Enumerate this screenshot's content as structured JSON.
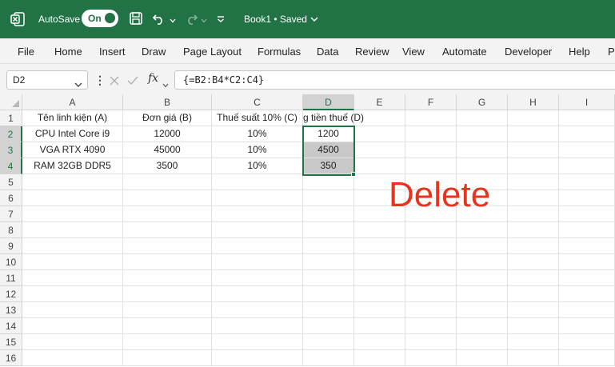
{
  "titlebar": {
    "autosave_label": "AutoSave",
    "autosave_state": "On",
    "document_title": "Book1 • Saved"
  },
  "ribbon": {
    "tabs": [
      "File",
      "Home",
      "Insert",
      "Draw",
      "Page Layout",
      "Formulas",
      "Data",
      "Review",
      "View",
      "Automate",
      "Developer",
      "Help",
      "Po"
    ]
  },
  "formula_bar": {
    "name_box": "D2",
    "fx_label": "fx",
    "formula": "{=B2:B4*C2:C4}"
  },
  "sheet": {
    "columns": [
      "A",
      "B",
      "C",
      "D",
      "E",
      "F",
      "G",
      "H",
      "I"
    ],
    "row_numbers": [
      "1",
      "2",
      "3",
      "4",
      "5",
      "6",
      "7",
      "8",
      "9",
      "10",
      "11",
      "12",
      "13",
      "14",
      "15",
      "16"
    ],
    "selected_column": "D",
    "selected_rows": [
      "2",
      "3",
      "4"
    ],
    "cells": {
      "A1": "Tên linh kiện (A)",
      "B1": "Đơn giá (B)",
      "C1": "Thuế suất 10% (C)",
      "D1": "g tiền thuế (D)",
      "A2": "CPU Intel Core i9",
      "B2": "12000",
      "C2": "10%",
      "D2": "1200",
      "A3": "VGA RTX 4090",
      "B3": "45000",
      "C3": "10%",
      "D3": "4500",
      "A4": "RAM 32GB DDR5",
      "B4": "3500",
      "C4": "10%",
      "D4": "350"
    }
  },
  "overlay": {
    "text": "Delete",
    "color": "#e8341c"
  },
  "colors": {
    "excel_green": "#217346",
    "selection_fill": "#c8c8c8"
  }
}
